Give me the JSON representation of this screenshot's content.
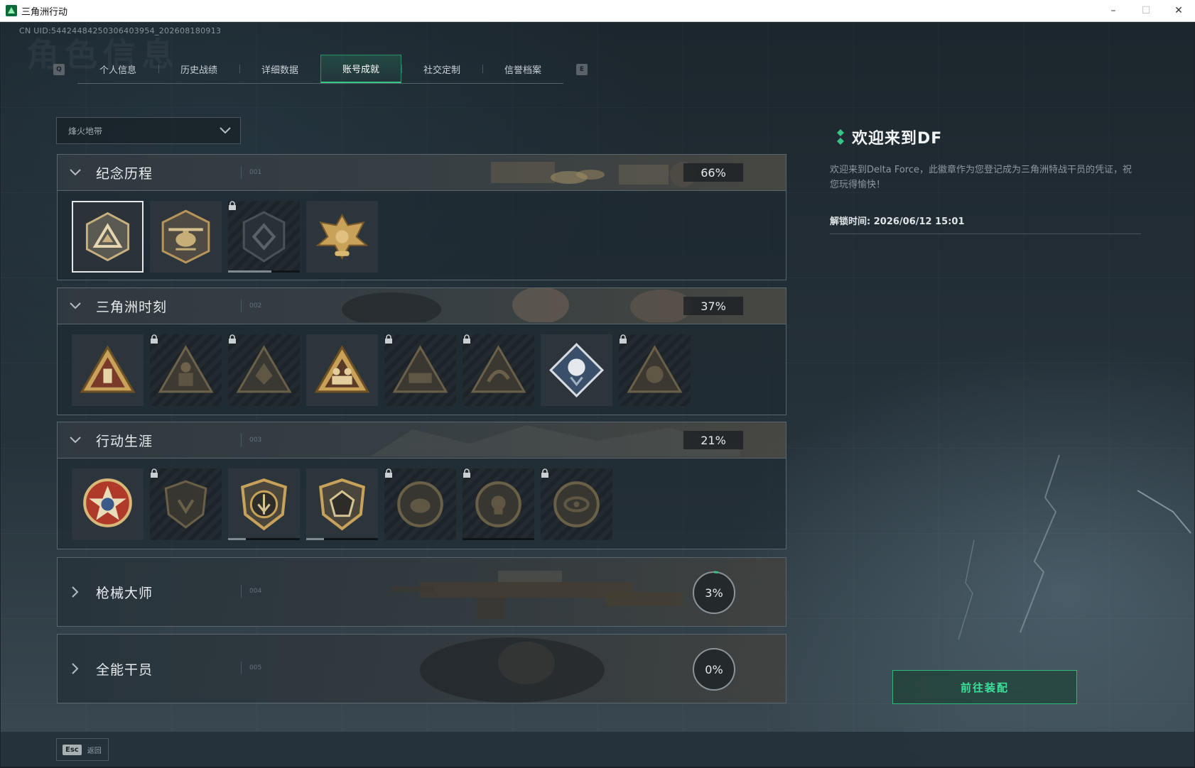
{
  "window": {
    "title": "三角洲行动",
    "minimize": "–",
    "maximize": "☐",
    "close": "✕"
  },
  "uid": "CN UID:5442448425030640395​4_202608180913",
  "page_bg_title": "角色信息",
  "tabs": {
    "prev_key": "Q",
    "next_key": "E",
    "items": [
      {
        "label": "个人信息",
        "active": false
      },
      {
        "label": "历史战绩",
        "active": false
      },
      {
        "label": "详细数据",
        "active": false
      },
      {
        "label": "账号成就",
        "active": true
      },
      {
        "label": "社交定制",
        "active": false
      },
      {
        "label": "信誉档案",
        "active": false
      }
    ]
  },
  "filter": {
    "selected": "烽火地带"
  },
  "sections": [
    {
      "title": "纪念历程",
      "code": "001",
      "percent": "66%",
      "expanded": true,
      "badges": [
        {
          "icon": "delta-triangle-badge",
          "locked": false,
          "selected": true
        },
        {
          "icon": "helicopter-badge",
          "locked": false
        },
        {
          "icon": "shield-emblem-badge",
          "locked": true
        },
        {
          "icon": "golden-eagle-badge",
          "locked": false
        }
      ]
    },
    {
      "title": "三角洲时刻",
      "code": "002",
      "percent": "37%",
      "expanded": true,
      "badges": [
        {
          "icon": "usb-triangle-badge",
          "locked": false
        },
        {
          "icon": "kneeling-soldier-badge",
          "locked": true
        },
        {
          "icon": "hands-triangle-badge",
          "locked": true
        },
        {
          "icon": "squad-triangle-badge",
          "locked": false
        },
        {
          "icon": "vehicle-triangle-badge",
          "locked": true
        },
        {
          "icon": "dragon-triangle-badge",
          "locked": true
        },
        {
          "icon": "rose-diamond-badge",
          "locked": false
        },
        {
          "icon": "skull-triangle-badge",
          "locked": true
        }
      ]
    },
    {
      "title": "行动生涯",
      "code": "003",
      "percent": "21%",
      "expanded": true,
      "badges": [
        {
          "icon": "star-medal-badge",
          "locked": false
        },
        {
          "icon": "wing-shield-badge",
          "locked": true
        },
        {
          "icon": "arrow-shield-badge",
          "locked": false,
          "progress": 0.25
        },
        {
          "icon": "gem-shield-badge",
          "locked": false,
          "progress": 0.25
        },
        {
          "icon": "helmet-disc-badge",
          "locked": true
        },
        {
          "icon": "skull-disc-badge",
          "locked": true
        },
        {
          "icon": "eye-disc-badge",
          "locked": true
        }
      ]
    },
    {
      "title": "枪械大师",
      "code": "004",
      "percent": "3%",
      "progress": 0.03,
      "expanded": false
    },
    {
      "title": "全能干员",
      "code": "005",
      "percent": "0%",
      "progress": 0.0,
      "expanded": false
    }
  ],
  "info": {
    "title": "欢迎来到DF",
    "description": "欢迎来到Delta Force，此徽章作为您登记成为三角洲特战干员的凭证，祝您玩得愉快！",
    "unlock_time": "解锁时间: 2026/06/12 15:01"
  },
  "equip_button": "前往装配",
  "footer": {
    "esc_key": "Esc",
    "back_label": "返回"
  },
  "colors": {
    "accent": "#35c585",
    "badge_gold": "#b8955a",
    "badge_dark": "#2b353b"
  }
}
